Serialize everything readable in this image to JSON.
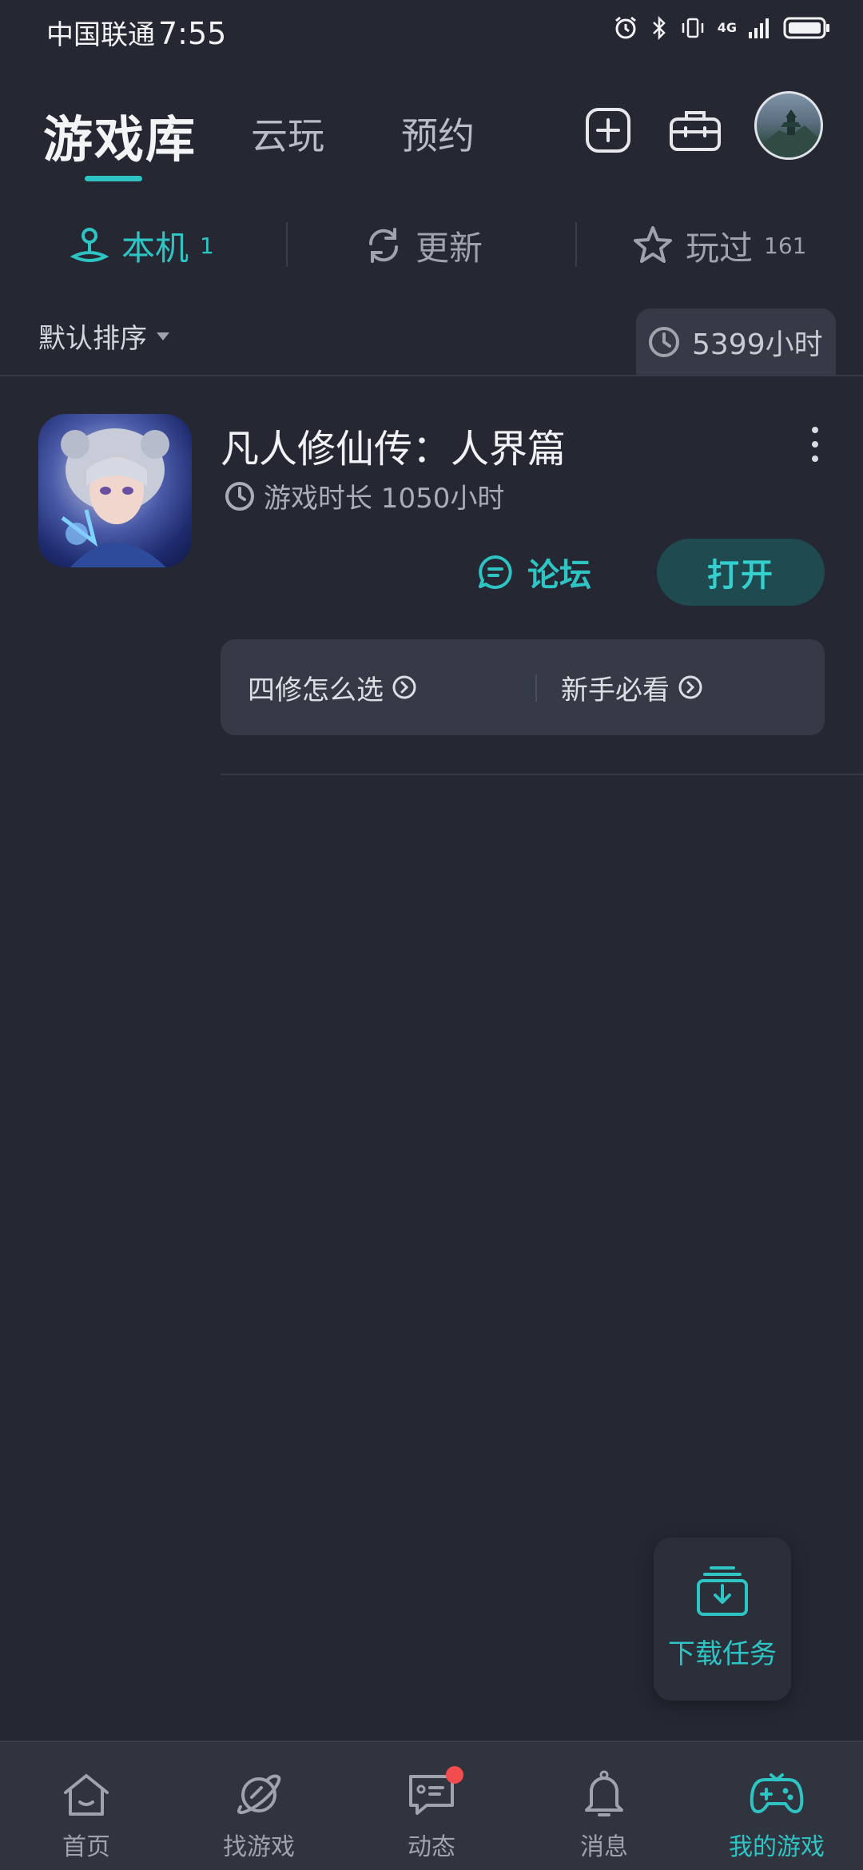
{
  "status_bar": {
    "carrier": "中国联通",
    "time": "7:55",
    "network": "4G"
  },
  "header": {
    "tabs": [
      {
        "label": "游戏库",
        "active": true
      },
      {
        "label": "云玩",
        "active": false
      },
      {
        "label": "预约",
        "active": false
      }
    ],
    "icons": [
      "add-icon",
      "toolbox-icon",
      "avatar"
    ]
  },
  "filters": [
    {
      "label": "本机",
      "count": "1",
      "icon": "joystick-icon",
      "active": true
    },
    {
      "label": "更新",
      "count": "",
      "icon": "refresh-icon",
      "active": false
    },
    {
      "label": "玩过",
      "count": "161",
      "icon": "star-icon",
      "active": false
    }
  ],
  "sort": {
    "label": "默认排序"
  },
  "total_hours": "5399小时",
  "game": {
    "title": "凡人修仙传：人界篇",
    "playtime": "游戏时长 1050小时",
    "forum_label": "论坛",
    "open_label": "打开",
    "tips": [
      {
        "label": "四修怎么选"
      },
      {
        "label": "新手必看"
      }
    ]
  },
  "download_tasks": {
    "label": "下载任务"
  },
  "bottom_nav": [
    {
      "label": "首页",
      "icon": "home-icon",
      "active": false
    },
    {
      "label": "找游戏",
      "icon": "planet-icon",
      "active": false
    },
    {
      "label": "动态",
      "icon": "chat-icon",
      "active": false,
      "badge": true
    },
    {
      "label": "消息",
      "icon": "bell-icon",
      "active": false
    },
    {
      "label": "我的游戏",
      "icon": "gamepad-icon",
      "active": true
    }
  ],
  "colors": {
    "accent": "#2ec4c4",
    "background": "#252833",
    "badge": "#f24c4c"
  }
}
